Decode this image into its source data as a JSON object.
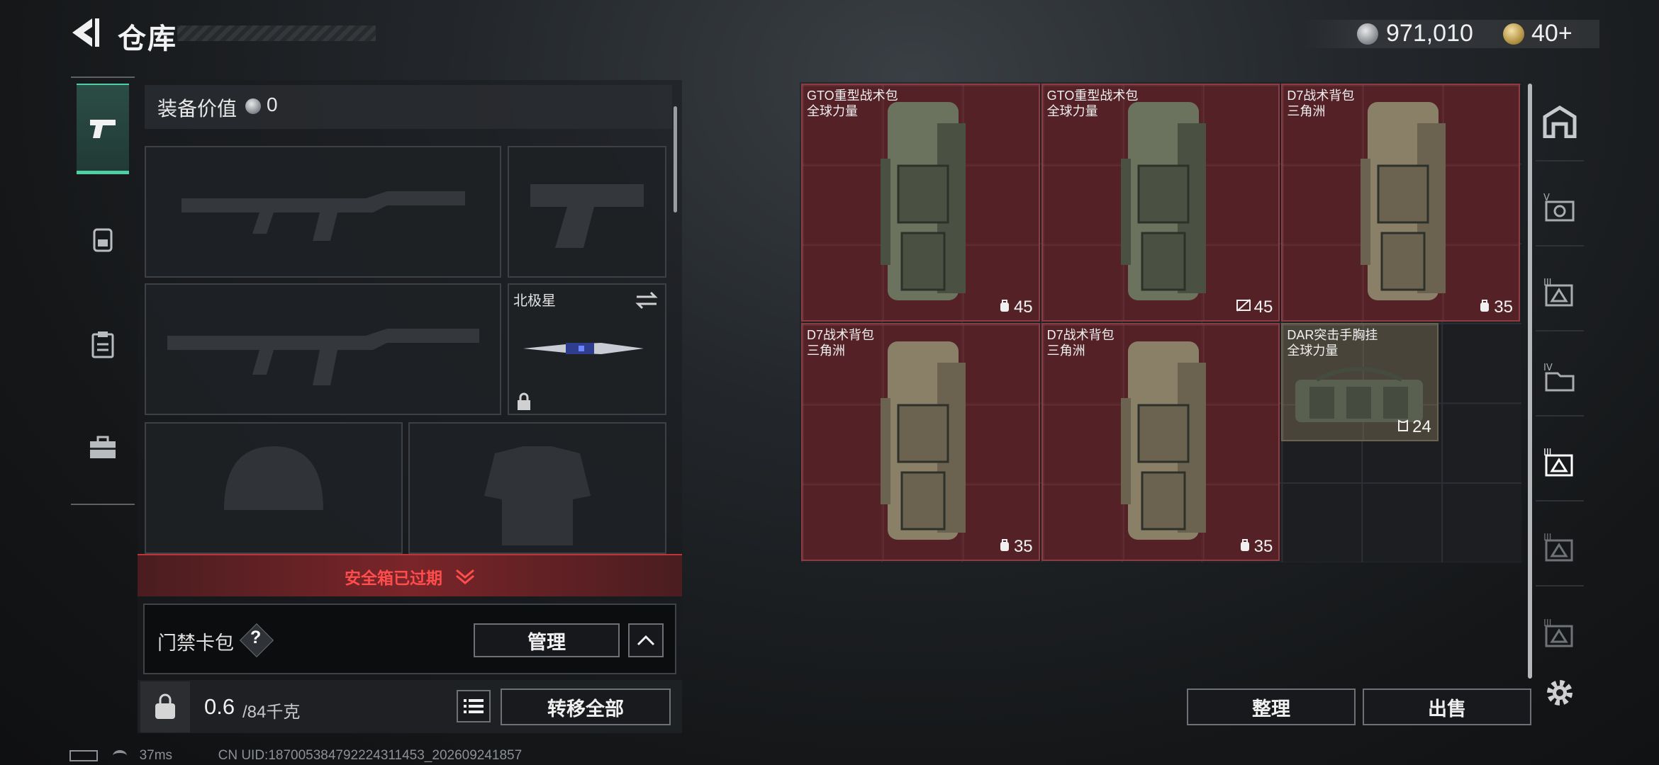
{
  "header": {
    "title": "仓库",
    "currency_silver": "971,010",
    "currency_gold": "40+"
  },
  "left_nav": [
    "weapon",
    "backpack",
    "clipboard",
    "toolbox"
  ],
  "equipment": {
    "label": "装备价值",
    "value": "0",
    "melee_label": "北极星",
    "safebox_status": "安全箱已过期",
    "card_pack_label": "门禁卡包",
    "help": "?",
    "manage_label": "管理",
    "weight_current": "0.6",
    "weight_max": "/84千克",
    "transfer_all_label": "转移全部"
  },
  "items": [
    {
      "name": "GTO重型战术包",
      "sub": "全球力量",
      "qty": "45",
      "qty_icon": "bag-capacity-icon"
    },
    {
      "name": "GTO重型战术包",
      "sub": "全球力量",
      "qty": "45",
      "qty_icon": "no-insure-icon"
    },
    {
      "name": "D7战术背包",
      "sub": "三角洲",
      "qty": "35",
      "qty_icon": "bag-capacity-icon"
    },
    {
      "name": "D7战术背包",
      "sub": "三角洲",
      "qty": "35",
      "qty_icon": "bag-capacity-icon"
    },
    {
      "name": "D7战术背包",
      "sub": "三角洲",
      "qty": "35",
      "qty_icon": "bag-capacity-icon"
    },
    {
      "name": "DAR突击手胸挂",
      "sub": "全球力量",
      "qty": "24",
      "qty_icon": "vest-capacity-icon"
    }
  ],
  "warehouse": {
    "sort_label": "整理",
    "sell_label": "出售"
  },
  "status": {
    "ping": "37ms",
    "uid": "CN UID:187005384792224311453_202609241857"
  },
  "colors": {
    "accent": "#4fd0a3",
    "item_bg": "#642228",
    "warning": "#ff4c4c"
  }
}
